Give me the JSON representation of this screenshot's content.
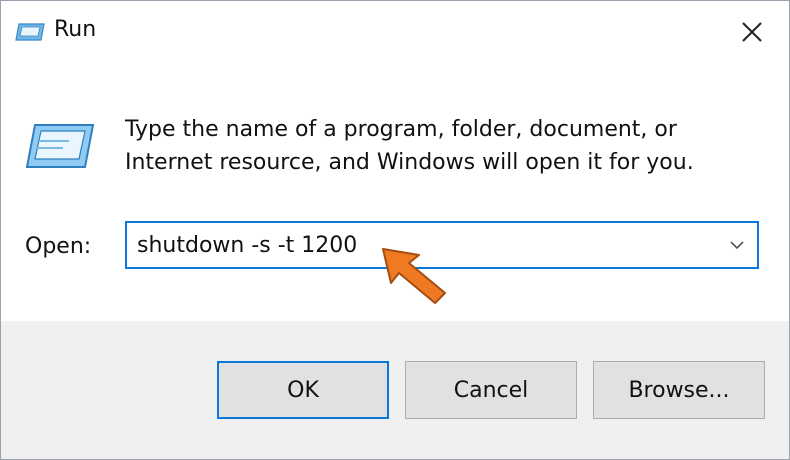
{
  "window": {
    "title": "Run",
    "close_icon": "close-icon"
  },
  "dialog": {
    "description_line1": "Type the name of a program, folder, document, or",
    "description_line2": "Internet resource, and Windows will open it for you.",
    "open_label": "Open:",
    "open_value": "shutdown -s -t 1200",
    "dropdown_icon": "chevron-down-icon"
  },
  "buttons": {
    "ok": "OK",
    "cancel": "Cancel",
    "browse": "Browse..."
  },
  "colors": {
    "accent": "#0a78d7",
    "pointer_arrow": "#f07a21",
    "footer_bg": "#f0f0f0"
  }
}
